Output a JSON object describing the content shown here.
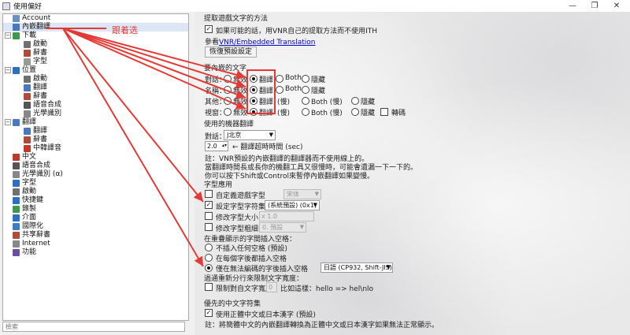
{
  "window": {
    "title": "使用偏好",
    "controls": {
      "minimize": "—",
      "restore": "❐",
      "close": "✕"
    }
  },
  "sidebar": {
    "items": [
      {
        "label": "Account",
        "level": 0,
        "icon": "user-icon",
        "color": "#6a8fc4"
      },
      {
        "label": "內嵌翻譯",
        "level": 0,
        "icon": "translate-icon",
        "color": "#4a78c0",
        "selected": true
      },
      {
        "label": "下載",
        "level": 0,
        "icon": "download-icon",
        "color": "#3c9a48",
        "toggle": "−"
      },
      {
        "label": "啟動",
        "level": 1,
        "icon": "gear-icon",
        "color": "#707070"
      },
      {
        "label": "辭書",
        "level": 1,
        "icon": "dictionary-icon",
        "color": "#b04a3a"
      },
      {
        "label": "字型",
        "level": 1,
        "icon": "font-icon",
        "color": "#999999"
      },
      {
        "label": "位置",
        "level": 0,
        "icon": "location-icon",
        "color": "#2f6fbf",
        "toggle": "−"
      },
      {
        "label": "啟動",
        "level": 1,
        "icon": "gear-icon",
        "color": "#707070"
      },
      {
        "label": "翻譯",
        "level": 1,
        "icon": "translate-icon",
        "color": "#4a78c0"
      },
      {
        "label": "辭書",
        "level": 1,
        "icon": "dictionary-icon",
        "color": "#b04a3a"
      },
      {
        "label": "語音合成",
        "level": 1,
        "icon": "speaker-icon",
        "color": "#555555"
      },
      {
        "label": "光學識別",
        "level": 1,
        "icon": "ocr-icon",
        "color": "#888888"
      },
      {
        "label": "翻譯",
        "level": 0,
        "icon": "translate-icon",
        "color": "#4a78c0",
        "toggle": "−"
      },
      {
        "label": "翻譯",
        "level": 1,
        "icon": "translate-icon",
        "color": "#4a78c0"
      },
      {
        "label": "辭書",
        "level": 1,
        "icon": "dictionary-icon",
        "color": "#b04a3a"
      },
      {
        "label": "中韓譯音",
        "level": 1,
        "icon": "language-icon",
        "color": "#c0392b"
      },
      {
        "label": "中文",
        "level": 0,
        "icon": "chinese-icon",
        "color": "#c0392b"
      },
      {
        "label": "語音合成",
        "level": 0,
        "icon": "speaker-icon",
        "color": "#555555"
      },
      {
        "label": "光學識別 (α)",
        "level": 0,
        "icon": "ocr-icon",
        "color": "#888888"
      },
      {
        "label": "字型",
        "level": 0,
        "icon": "font-icon",
        "color": "#2f6fbf"
      },
      {
        "label": "啟動",
        "level": 0,
        "icon": "gear-icon",
        "color": "#707070"
      },
      {
        "label": "快捷鍵",
        "level": 0,
        "icon": "keyboard-icon",
        "color": "#2f6fbf"
      },
      {
        "label": "錄製",
        "level": 0,
        "icon": "record-icon",
        "color": "#3c9a48"
      },
      {
        "label": "介面",
        "level": 0,
        "icon": "interface-icon",
        "color": "#2f6fbf"
      },
      {
        "label": "國際化",
        "level": 0,
        "icon": "globe-icon",
        "color": "#3a7fc0"
      },
      {
        "label": "共享辭書",
        "level": 0,
        "icon": "shared-dictionary-icon",
        "color": "#b04a3a"
      },
      {
        "label": "Internet",
        "level": 0,
        "icon": "internet-icon",
        "color": "#888888"
      },
      {
        "label": "功能",
        "level": 0,
        "icon": "feature-icon",
        "color": "#6a4fa0"
      }
    ],
    "search_placeholder": "檢索"
  },
  "annotation": {
    "text": "跟着选"
  },
  "extract": {
    "title": "提取遊戲文字的方法",
    "use_vnr_checkbox": "如果可能的話，用VNR自己的提取方法而不使用ITH",
    "see_prefix": "參看",
    "see_link": "VNR/Embedded Translation",
    "reset_button": "恢復預設設定"
  },
  "embedded_text": {
    "title": "要內嵌的文字",
    "rows": [
      {
        "label": "對話：",
        "options": [
          "無效",
          "翻譯",
          "Both",
          "隱藏"
        ],
        "selected": 1
      },
      {
        "label": "名稱：",
        "options": [
          "無效",
          "翻譯",
          "Both",
          "隱藏"
        ],
        "selected": 1
      },
      {
        "label": "其他：",
        "options": [
          "無效",
          "翻譯",
          "(慢)",
          "Both (慢)",
          "隱藏"
        ],
        "selected": 1
      },
      {
        "label": "視窗：",
        "options": [
          "無效",
          "翻譯",
          "(慢)",
          "Both (慢)",
          "隱藏"
        ],
        "selected": 1,
        "extra_checkbox": "轉碼"
      }
    ]
  },
  "machine": {
    "title": "使用的機器翻譯",
    "dialog_label": "對話：",
    "engine": "J北京",
    "timeout_value": "2.0",
    "timeout_label": "← 翻譯超時時間 (sec)",
    "notes": [
      "註：VNR預設的內嵌翻譯的翻譯器而不使用線上的。",
      "當翻譯時間長或長你的機翻工具又很慢時，可能會遺漏一下一下的。",
      "你可以按下Shift或Control來暫停內嵌翻譯如果變慢。"
    ]
  },
  "font": {
    "title": "字型應用",
    "custom_font": {
      "label": "自定義遊戲字型",
      "value": "宋体"
    },
    "charset": {
      "label": "設定字型字符集",
      "value": "(系統預設) (0x1)"
    },
    "font_size": {
      "label": "修改字型大小",
      "value": "x 1.0"
    },
    "font_weight": {
      "label": "修改字型粗細",
      "value": "0. 預設"
    }
  },
  "spacing": {
    "title": "在重疊顯示的字間插入空格：",
    "options": [
      "不插入任何空格 (預設)",
      "在每個字後都插入空格",
      "僅在無法編碼的字後插入空格"
    ],
    "selected": 2,
    "encoding_value": "日語 (CP932, Shift-JIS)"
  },
  "wrap": {
    "title": "過通重新分行來限制文字寬度：",
    "checkbox": "限制對自文字寬度",
    "value": "0",
    "example": "比如這樣：hello => hel\\nlo"
  },
  "chinese": {
    "title": "優先的中文字符集",
    "checkbox": "使用正體中文或日本漢字 (預設)",
    "note": "註：將簡體中文的內嵌翻譯轉換為正體中文或日本漢字如果無法正常顯示。"
  }
}
